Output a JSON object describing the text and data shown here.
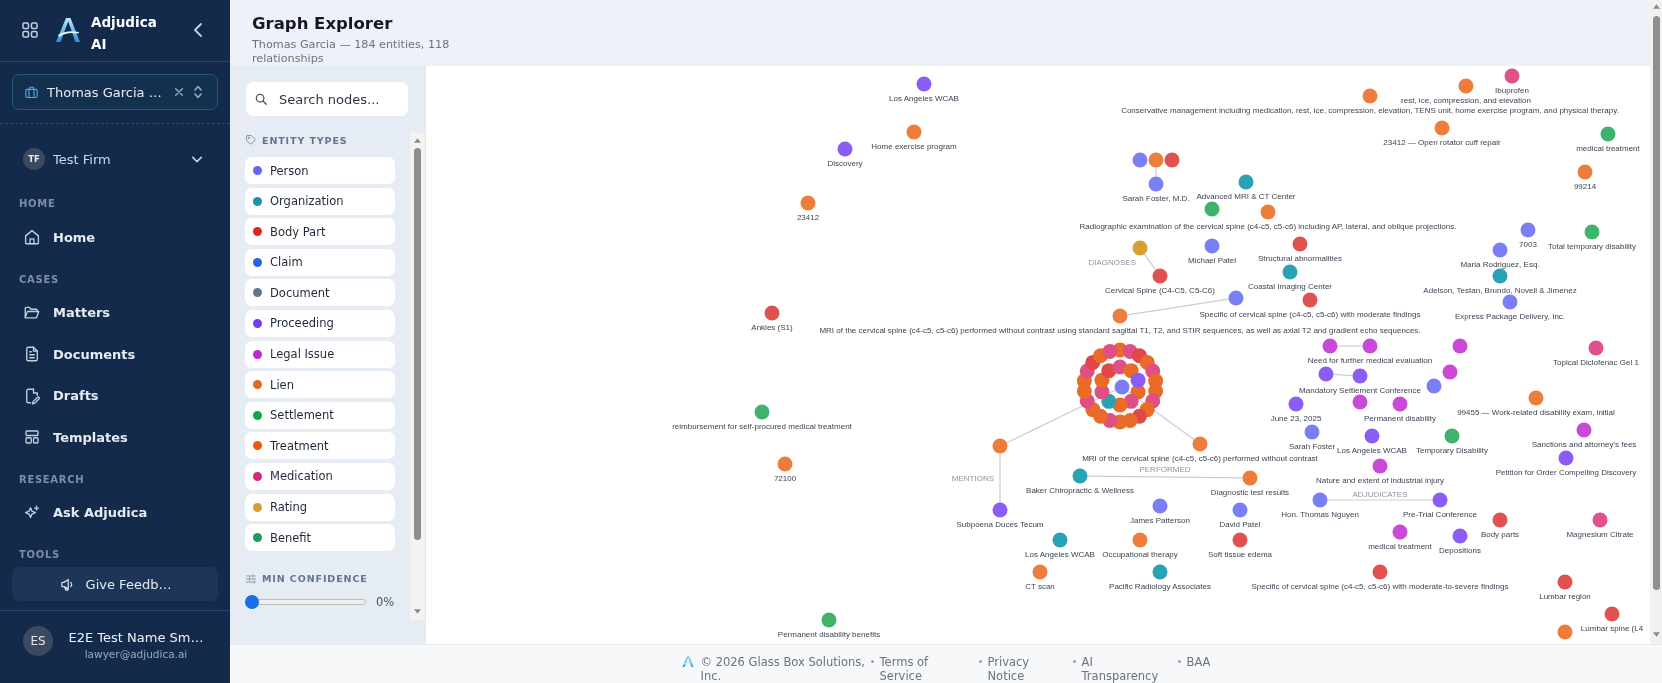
{
  "sidebar": {
    "brand": "Adjudica AI",
    "matter": "Thomas Garcia …",
    "firm": {
      "initials": "TF",
      "name": "Test Firm"
    },
    "sections": [
      {
        "heading": "HOME",
        "items": [
          {
            "label": "Home",
            "kind": "home",
            "selected": false
          }
        ]
      },
      {
        "heading": "CASES",
        "items": [
          {
            "label": "Matters",
            "kind": "folder",
            "selected": false
          },
          {
            "label": "Documents",
            "kind": "document",
            "selected": false
          },
          {
            "label": "Drafts",
            "kind": "draft",
            "selected": false
          },
          {
            "label": "Templates",
            "kind": "template",
            "selected": false
          }
        ]
      },
      {
        "heading": "RESEARCH",
        "items": [
          {
            "label": "Ask Adjudica",
            "kind": "sparkle",
            "selected": false
          }
        ]
      },
      {
        "heading": "TOOLS",
        "items": [
          {
            "label": "Give Feedb…",
            "kind": "feedback",
            "selected": false
          }
        ]
      }
    ],
    "user": {
      "initials": "ES",
      "name": "E2E Test Name Sm…",
      "email": "lawyer@adjudica.ai"
    }
  },
  "header": {
    "title": "Graph Explorer",
    "subtitle": "Thomas Garcia — 184 entities, 118 relationships"
  },
  "filters": {
    "search": {
      "placeholder": "Search nodes..."
    },
    "entity_types": {
      "heading": "ENTITY TYPES",
      "items": [
        {
          "label": "Person",
          "color": "#6366f1"
        },
        {
          "label": "Organization",
          "color": "#1f8fb3"
        },
        {
          "label": "Body Part",
          "color": "#dc2626"
        },
        {
          "label": "Claim",
          "color": "#2563eb"
        },
        {
          "label": "Document",
          "color": "#64748b"
        },
        {
          "label": "Proceeding",
          "color": "#7c3aed"
        },
        {
          "label": "Legal Issue",
          "color": "#c026d3"
        },
        {
          "label": "Lien",
          "color": "#dd6b20"
        },
        {
          "label": "Settlement",
          "color": "#16a34a"
        },
        {
          "label": "Treatment",
          "color": "#ea580c"
        },
        {
          "label": "Medication",
          "color": "#db2777"
        },
        {
          "label": "Rating",
          "color": "#d69e2e"
        },
        {
          "label": "Benefit",
          "color": "#15a05a"
        }
      ]
    },
    "min_confidence": {
      "heading": "MIN CONFIDENCE",
      "level": 0,
      "reading": "0%"
    }
  },
  "graph": {
    "nodes": [
      {
        "label": "Ibuprofen",
        "color": "#e0508a"
      },
      {
        "label": "Los Angeles WCAB",
        "color": "#8b5cf6"
      },
      {
        "label": "rest, ice, compression, and elevation",
        "color": "#ed7d3b"
      },
      {
        "label": "Conservative management including medication, rest, ice, compression, elevation, TENS unit, home exercise program, and physical therapy.",
        "color": "#ed7d3b"
      },
      {
        "label": "Home exercise program",
        "color": "#ed7d3b"
      },
      {
        "label": "23412 — Open rotator cuff repair",
        "color": "#ed7d3b"
      },
      {
        "label": "medical treatment",
        "color": "#3fb36b"
      },
      {
        "label": "Discovery",
        "color": "#8b5cf6"
      },
      {
        "color": "#7b7ff5"
      },
      {
        "color": "#ed7d3b"
      },
      {
        "color": "#e05252"
      },
      {
        "label": "99214",
        "color": "#ed7d3b"
      },
      {
        "label": "Sarah Foster, M.D.",
        "color": "#7b7ff5"
      },
      {
        "label": "Advanced MRI & CT Center",
        "color": "#2aa1b5"
      },
      {
        "label": "23412",
        "color": "#ed7d3b"
      },
      {
        "color": "#3fb36b"
      },
      {
        "label": "Radiographic examination of the cervical spine (c4-c5, c5-c6) including AP, lateral, and oblique projections.",
        "color": "#ed7d3b"
      },
      {
        "label": "7003",
        "color": "#7b7ff5"
      },
      {
        "label": "Total temporary disability",
        "color": "#3fb36b"
      },
      {
        "color": "#d6a030"
      },
      {
        "label": "Michael Patel",
        "color": "#7b7ff5"
      },
      {
        "label": "Structural abnormalities",
        "color": "#e05252"
      },
      {
        "label": "Maria Rodriguez, Esq.",
        "color": "#7b7ff5"
      },
      {
        "label": "Cervical Spine (C4-C5, C5-C6)",
        "color": "#e05252"
      },
      {
        "label": "Coastal Imaging Center",
        "color": "#2aa1b5"
      },
      {
        "label": "Adelson, Testan, Brundo, Novell & Jimenez",
        "color": "#2aa1b5"
      },
      {
        "color": "#7b7ff5"
      },
      {
        "label": "Specific of cervical spine (c4-c5, c5-c6) with moderate findings",
        "color": "#e05252"
      },
      {
        "label": "Express Package Delivery, Inc.",
        "color": "#7b7ff5"
      },
      {
        "label": "Ankles (S1)",
        "color": "#e05252"
      },
      {
        "label": "MRI of the cervical spine (c4-c5, c5-c6) performed without contrast using standard sagittal T1, T2, and STIR sequences, as well as axial T2 and gradient echo sequences.",
        "color": "#ed7d3b"
      },
      {
        "color": "#c94ad9"
      },
      {
        "label": "Need for further medical evaluation",
        "color": "#c94ad9"
      },
      {
        "color": "#c94ad9"
      },
      {
        "label": "Topical Diclofenac Gel 1",
        "color": "#e0508a"
      },
      {
        "color": "#8b5cf6"
      },
      {
        "label": "Mandatory Settlement Conference",
        "color": "#8b5cf6"
      },
      {
        "color": "#c94ad9"
      },
      {
        "color": "#7b7ff5"
      },
      {
        "label": "June 23, 2025",
        "color": "#8b5cf6"
      },
      {
        "color": "#c94ad9"
      },
      {
        "label": "Permanent disability",
        "color": "#c94ad9"
      },
      {
        "label": "99455 — Work-related disability exam, initial",
        "color": "#ed7d3b"
      },
      {
        "label": "reimbursement for self-procured medical treatment",
        "color": "#3fb36b"
      },
      {
        "label": "Sarah Foster",
        "color": "#7b7ff5"
      },
      {
        "label": "Los Angeles WCAB",
        "color": "#8b5cf6"
      },
      {
        "label": "Temporary Disability",
        "color": "#3fb36b"
      },
      {
        "label": "Sanctions and attorney's fees",
        "color": "#c94ad9"
      },
      {
        "color": "#ed7d3b"
      },
      {
        "label": "MRI of the cervical spine (c4-c5, c5-c6) performed without contrast",
        "color": "#ed7d3b"
      },
      {
        "label": "72100",
        "color": "#ed7d3b"
      },
      {
        "label": "Nature and extent of industrial injury",
        "color": "#c94ad9"
      },
      {
        "label": "Petition for Order Compelling Discovery",
        "color": "#8b5cf6"
      },
      {
        "label": "Baker Chiropractic & Wellness",
        "color": "#2aa1b5"
      },
      {
        "label": "Diagnostic test results",
        "color": "#ed7d3b"
      },
      {
        "label": "Hon. Thomas Nguyen",
        "color": "#7b7ff5"
      },
      {
        "label": "Pre-Trial Conference",
        "color": "#8b5cf6"
      },
      {
        "label": "Subpoena Duces Tecum",
        "color": "#8b5cf6"
      },
      {
        "label": "James Patterson",
        "color": "#7b7ff5"
      },
      {
        "label": "David Patel",
        "color": "#7b7ff5"
      },
      {
        "label": "Body parts",
        "color": "#e05252"
      },
      {
        "label": "Magnesium Citrate",
        "color": "#e0508a"
      },
      {
        "label": "medical treatment",
        "color": "#c94ad9"
      },
      {
        "label": "Depositions",
        "color": "#8b5cf6"
      },
      {
        "label": "Los Angeles WCAB",
        "color": "#2aa1b5"
      },
      {
        "label": "Occupational therapy",
        "color": "#ed7d3b"
      },
      {
        "label": "Soft tissue edema",
        "color": "#e05252"
      },
      {
        "label": "CT scan",
        "color": "#ed7d3b"
      },
      {
        "label": "Pacific Radiology Associates",
        "color": "#2aa1b5"
      },
      {
        "label": "Specific of cervical spine (c4-c5, c5-c6) with moderate-to-severe findings",
        "color": "#e05252"
      },
      {
        "label": "Lumbar region",
        "color": "#e05252"
      },
      {
        "label": "Lumbar spine (L4",
        "color": "#e05252"
      },
      {
        "label": "Permanent disability benefits",
        "color": "#3fb36b"
      },
      {
        "color": "#ed7d3b"
      },
      {
        "color": "#ea6a28"
      },
      {
        "color": "#de4f86"
      },
      {
        "color": "#e04848"
      },
      {
        "color": "#ea6a28"
      },
      {
        "color": "#de4f86"
      },
      {
        "color": "#ea6a28"
      },
      {
        "color": "#ea6a28"
      },
      {
        "color": "#de4f86"
      },
      {
        "color": "#ea6a28"
      },
      {
        "color": "#e04848"
      },
      {
        "color": "#ea6a28"
      },
      {
        "color": "#ea6a28"
      },
      {
        "color": "#de4f86"
      },
      {
        "color": "#ea6a28"
      },
      {
        "color": "#ea6a28"
      },
      {
        "color": "#de4f86"
      },
      {
        "color": "#ea6a28"
      },
      {
        "color": "#ea6a28"
      },
      {
        "color": "#de4f86"
      },
      {
        "color": "#e04848"
      },
      {
        "color": "#ea6a28"
      },
      {
        "color": "#de4f86"
      },
      {
        "color": "#ea6a28"
      },
      {
        "color": "#de4f86"
      },
      {
        "color": "#ea6a28"
      },
      {
        "color": "#2aa1b5"
      },
      {
        "color": "#de4f86"
      },
      {
        "color": "#ea6a28"
      },
      {
        "color": "#e04848"
      },
      {
        "color": "#de4f86"
      },
      {
        "color": "#ea6a28"
      },
      {
        "color": "#8b5cf6"
      },
      {
        "color": "#7b7ff5"
      }
    ],
    "edges": [
      {
        "label": "DIAGNOSES"
      },
      {
        "label": "PERFORMED"
      },
      {
        "label": "MENTIONS"
      },
      {
        "label": "ADJUDICATES"
      }
    ]
  },
  "footer": {
    "copyright": "© 2026 Glass Box Solutions, Inc.",
    "links": [
      "Terms of Service",
      "Privacy Notice",
      "AI Transparency",
      "BAA"
    ]
  }
}
